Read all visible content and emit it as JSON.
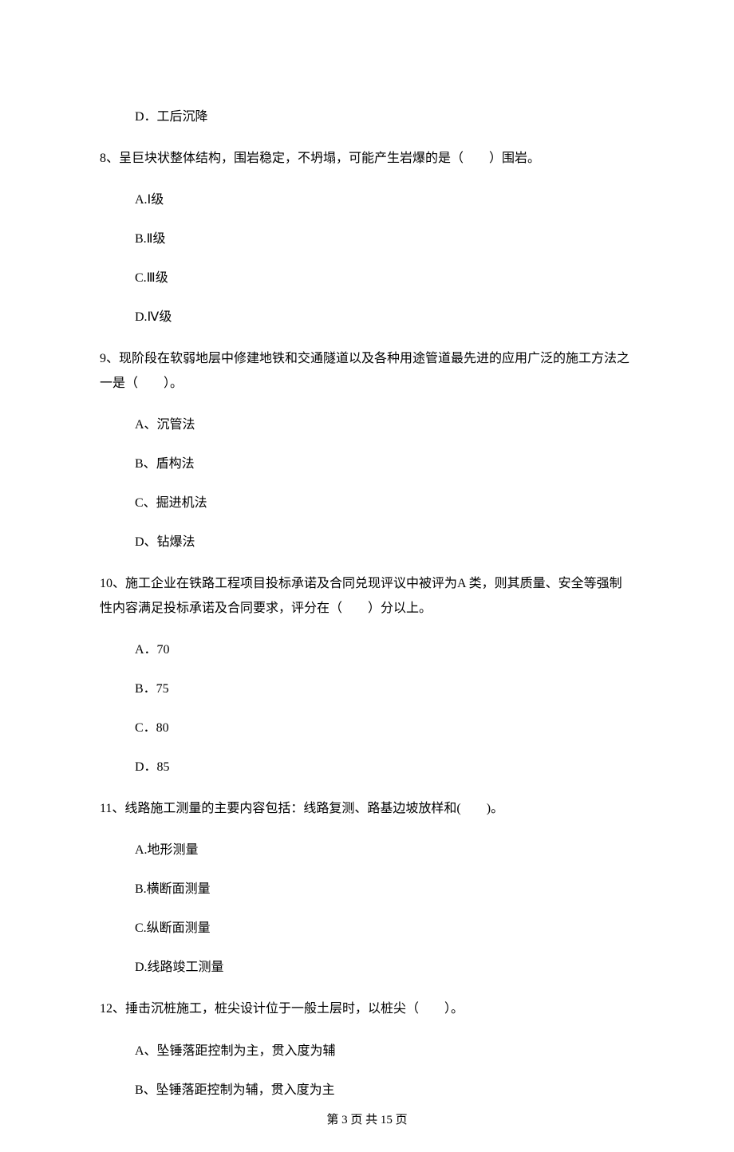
{
  "q7_optD": "D．工后沉降",
  "q8": {
    "stem": "8、呈巨块状整体结构，围岩稳定，不坍塌，可能产生岩爆的是（　　）围岩。",
    "optA": "A.Ⅰ级",
    "optB": "B.Ⅱ级",
    "optC": "C.Ⅲ级",
    "optD": "D.Ⅳ级"
  },
  "q9": {
    "stem": "9、现阶段在软弱地层中修建地铁和交通隧道以及各种用途管道最先进的应用广泛的施工方法之一是（　　）。",
    "optA": "A、沉管法",
    "optB": "B、盾构法",
    "optC": "C、掘进机法",
    "optD": "D、钻爆法"
  },
  "q10": {
    "stem": "10、施工企业在铁路工程项目投标承诺及合同兑现评议中被评为A 类，则其质量、安全等强制性内容满足投标承诺及合同要求，评分在（　　）分以上。",
    "optA": "A．70",
    "optB": "B．75",
    "optC": "C．80",
    "optD": "D．85"
  },
  "q11": {
    "stem": "11、线路施工测量的主要内容包括：线路复测、路基边坡放样和(　　)。",
    "optA": "A.地形测量",
    "optB": "B.横断面测量",
    "optC": "C.纵断面测量",
    "optD": "D.线路竣工测量"
  },
  "q12": {
    "stem": "12、捶击沉桩施工，桩尖设计位于一般土层时，以桩尖（　　）。",
    "optA": "A、坠锤落距控制为主，贯入度为辅",
    "optB": "B、坠锤落距控制为辅，贯入度为主"
  },
  "footer": "第 3 页 共 15 页"
}
